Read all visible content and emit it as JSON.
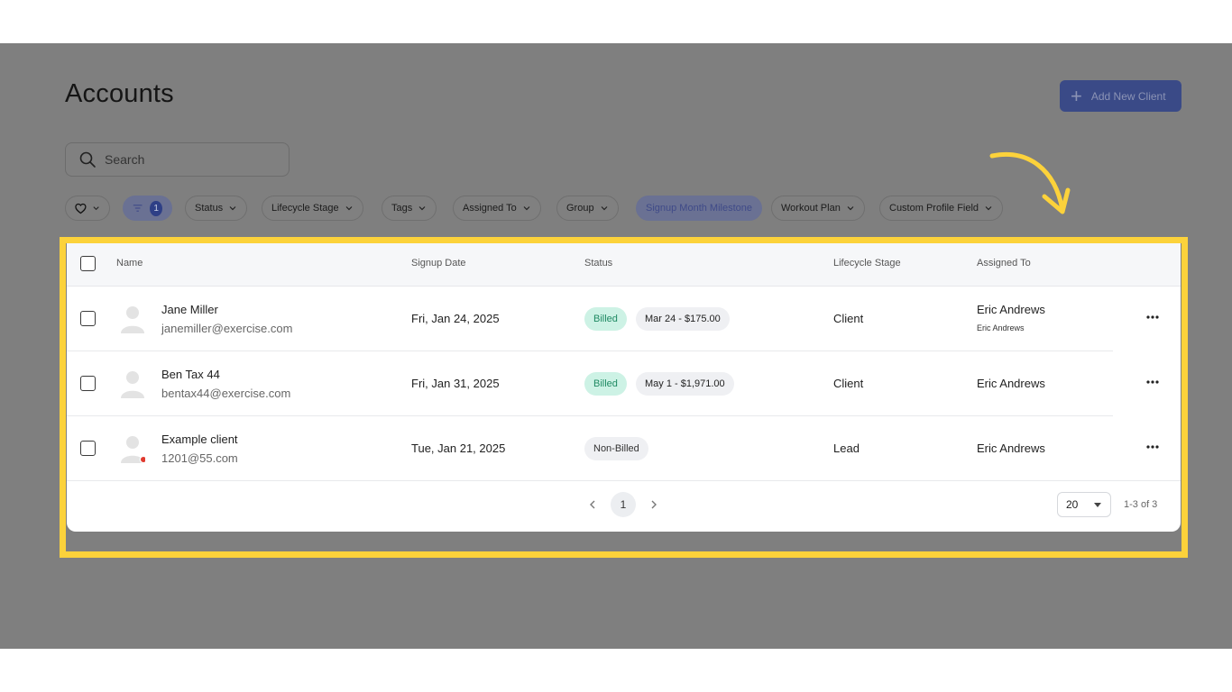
{
  "page": {
    "title": "Accounts"
  },
  "header": {
    "add_button_label": "Add New Client"
  },
  "search": {
    "placeholder": "Search"
  },
  "filters": {
    "filter_count": "1",
    "chips": [
      "Status",
      "Lifecycle Stage",
      "Tags",
      "Assigned To",
      "Group",
      "Signup Month Milestone",
      "Workout Plan",
      "Custom Profile Field"
    ]
  },
  "table": {
    "columns": {
      "name": "Name",
      "signup_date": "Signup Date",
      "status": "Status",
      "lifecycle_stage": "Lifecycle Stage",
      "assigned_to": "Assigned To"
    },
    "rows": [
      {
        "name": "Jane Miller",
        "email": "janemiller@exercise.com",
        "signup_date": "Fri, Jan 24, 2025",
        "status": "Billed",
        "billing": "Mar 24 - $175.00",
        "lifecycle_stage": "Client",
        "assigned_to": "Eric Andrews",
        "assigned_sub": "Eric Andrews"
      },
      {
        "name": "Ben Tax 44",
        "email": "bentax44@exercise.com",
        "signup_date": "Fri, Jan 31, 2025",
        "status": "Billed",
        "billing": "May 1 - $1,971.00",
        "lifecycle_stage": "Client",
        "assigned_to": "Eric Andrews"
      },
      {
        "name": "Example client",
        "email": "1201@55.com",
        "signup_date": "Tue, Jan 21, 2025",
        "status": "Non-Billed",
        "lifecycle_stage": "Lead",
        "assigned_to": "Eric Andrews"
      }
    ]
  },
  "pagination": {
    "current_page": "1",
    "per_page": "20",
    "range": "1-3 of 3"
  },
  "colors": {
    "highlight": "#fcd23b",
    "accent": "#3a4a87",
    "billed_bg": "#cdf2e5",
    "billed_text": "#1f8a63",
    "status_dot": "#e03a2f"
  }
}
